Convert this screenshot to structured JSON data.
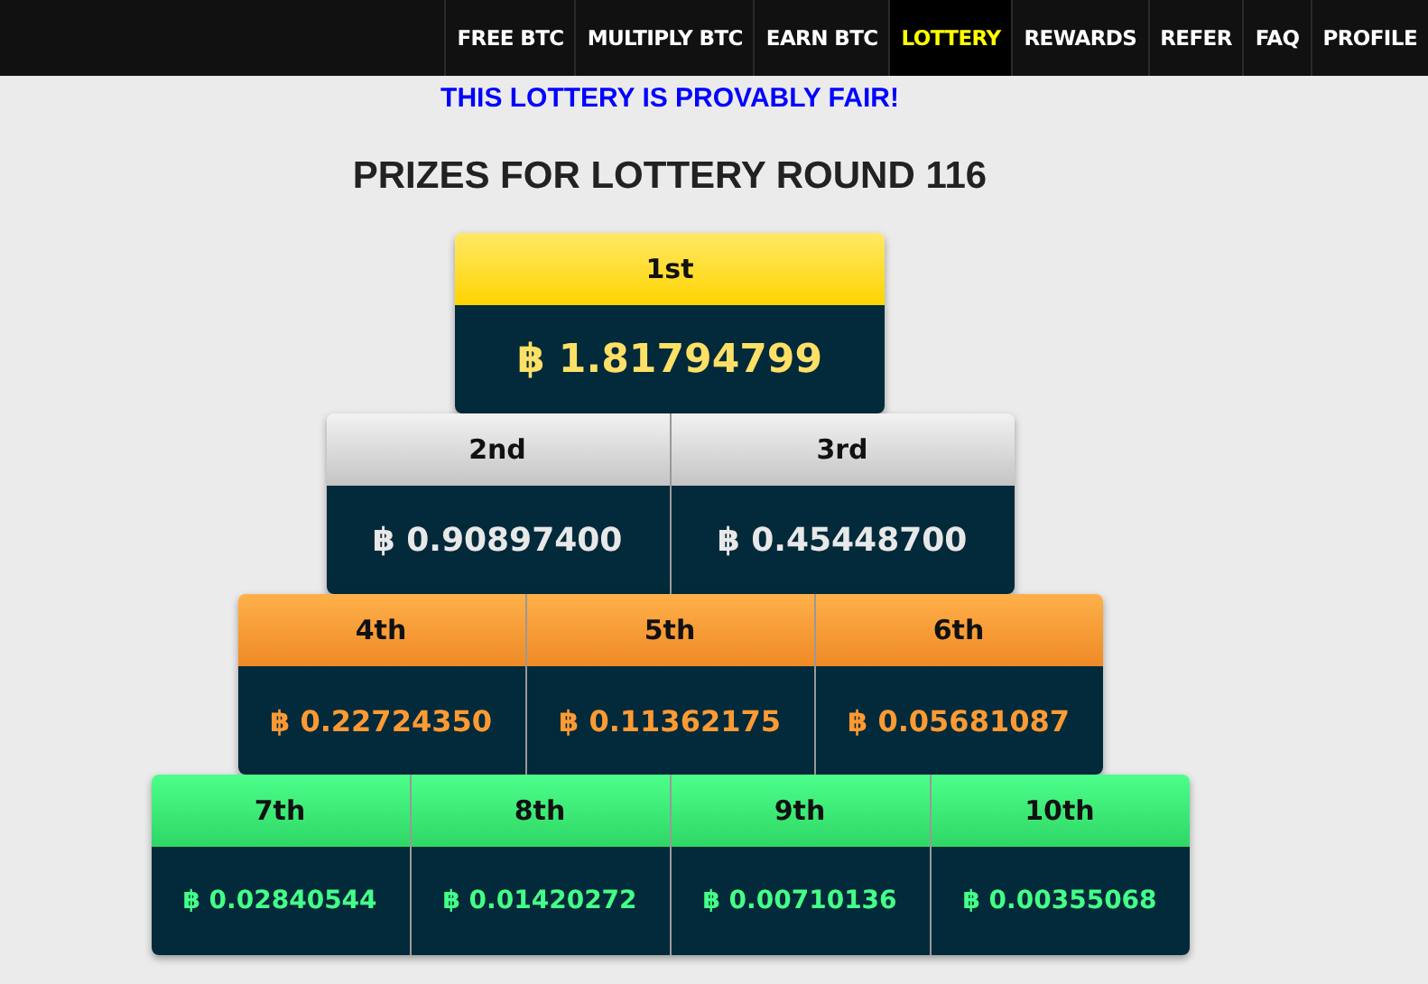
{
  "nav": [
    {
      "label": "FREE BTC",
      "selected": false
    },
    {
      "label": "MULTIPLY BTC",
      "selected": false
    },
    {
      "label": "EARN BTC",
      "selected": false
    },
    {
      "label": "LOTTERY",
      "selected": true
    },
    {
      "label": "REWARDS",
      "selected": false
    },
    {
      "label": "REFER",
      "selected": false
    },
    {
      "label": "FAQ",
      "selected": false
    },
    {
      "label": "PROFILE",
      "selected": false
    }
  ],
  "notice": "THIS LOTTERY IS PROVABLY FAIR!",
  "title": "PRIZES FOR LOTTERY ROUND 116",
  "tiers": [
    {
      "kind": "gold",
      "prizes": [
        {
          "place": "1st",
          "amount": "฿ 1.81794799"
        }
      ]
    },
    {
      "kind": "silver",
      "prizes": [
        {
          "place": "2nd",
          "amount": "฿ 0.90897400"
        },
        {
          "place": "3rd",
          "amount": "฿ 0.45448700"
        }
      ]
    },
    {
      "kind": "bronze",
      "prizes": [
        {
          "place": "4th",
          "amount": "฿ 0.22724350"
        },
        {
          "place": "5th",
          "amount": "฿ 0.11362175"
        },
        {
          "place": "6th",
          "amount": "฿ 0.05681087"
        }
      ]
    },
    {
      "kind": "green",
      "prizes": [
        {
          "place": "7th",
          "amount": "฿ 0.02840544"
        },
        {
          "place": "8th",
          "amount": "฿ 0.01420272"
        },
        {
          "place": "9th",
          "amount": "฿ 0.00710136"
        },
        {
          "place": "10th",
          "amount": "฿ 0.00355068"
        }
      ]
    }
  ]
}
